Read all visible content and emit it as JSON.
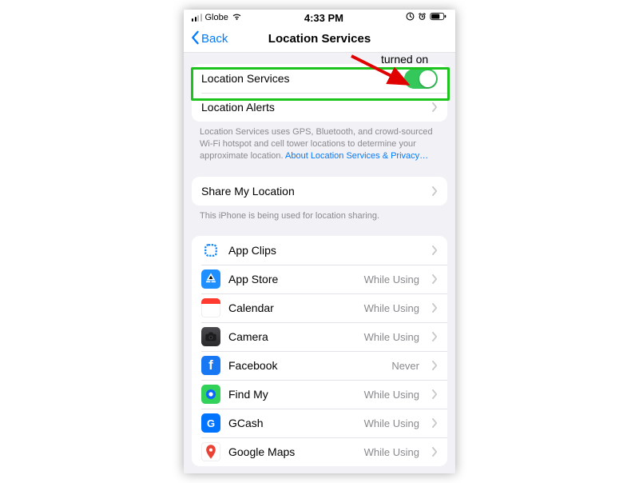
{
  "status": {
    "carrier": "Globe",
    "time": "4:33 PM"
  },
  "nav": {
    "back_label": "Back",
    "title": "Location Services"
  },
  "toggle_row": {
    "label": "Location Services"
  },
  "alerts_row": {
    "label": "Location Alerts"
  },
  "privacy_footer": {
    "text": "Location Services uses GPS, Bluetooth, and crowd-sourced Wi-Fi hotspot and cell tower locations to determine your approximate location. ",
    "link": "About Location Services & Privacy…"
  },
  "share_row": {
    "label": "Share My Location"
  },
  "share_footer": "This iPhone is being used for location sharing.",
  "apps": [
    {
      "name": "App Clips",
      "status": "",
      "icon": "appclips"
    },
    {
      "name": "App Store",
      "status": "While Using",
      "icon": "appstore"
    },
    {
      "name": "Calendar",
      "status": "While Using",
      "icon": "calendar"
    },
    {
      "name": "Camera",
      "status": "While Using",
      "icon": "camera"
    },
    {
      "name": "Facebook",
      "status": "Never",
      "icon": "facebook"
    },
    {
      "name": "Find My",
      "status": "While Using",
      "icon": "findmy"
    },
    {
      "name": "GCash",
      "status": "While Using",
      "icon": "gcash"
    },
    {
      "name": "Google Maps",
      "status": "While Using",
      "icon": "gmaps"
    }
  ],
  "annotation": {
    "label": "turned on"
  }
}
